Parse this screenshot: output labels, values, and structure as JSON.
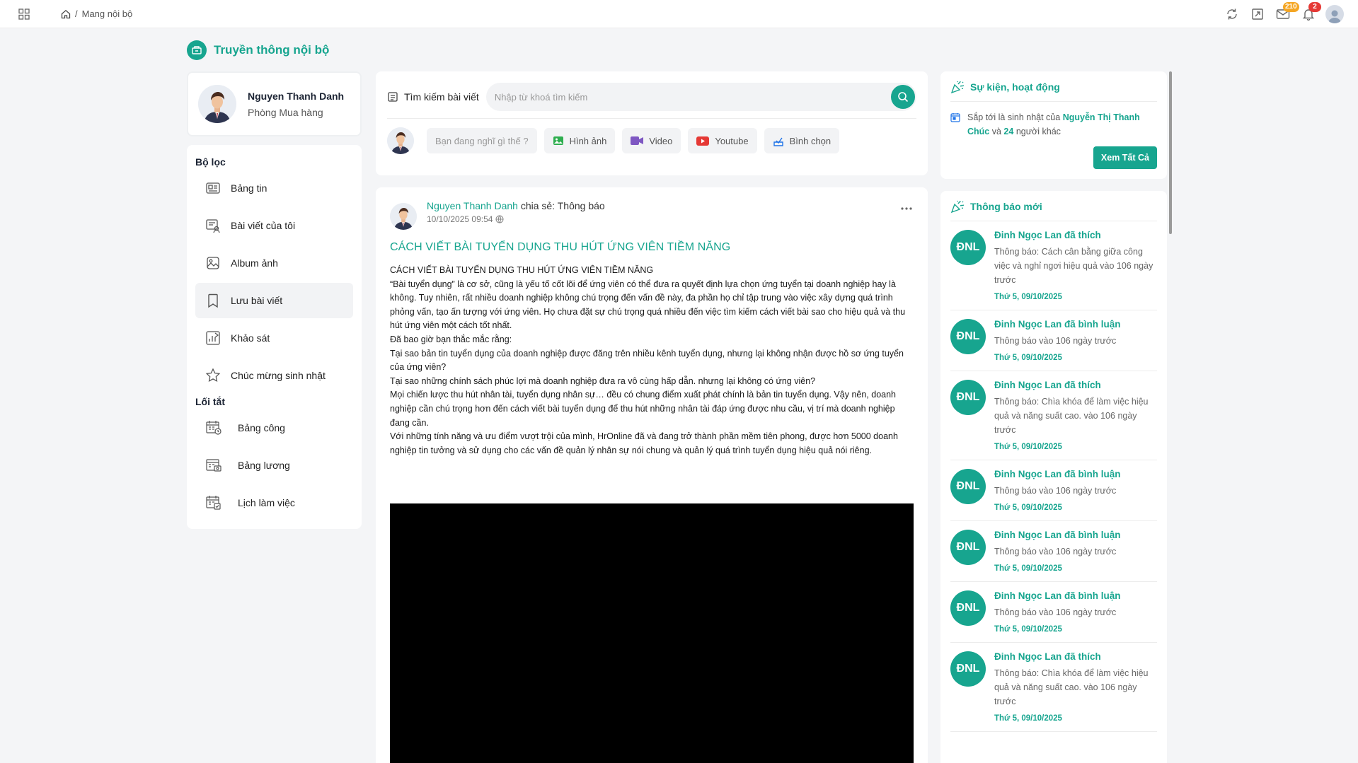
{
  "topbar": {
    "breadcrumb_sep": "/",
    "breadcrumb_current": "Mang nội bộ",
    "mail_badge": "210",
    "bell_badge": "2"
  },
  "page": {
    "title": "Truyền thông nội bộ"
  },
  "profile": {
    "name": "Nguyen Thanh Danh",
    "department": "Phòng Mua hàng"
  },
  "filters": {
    "heading": "Bộ lọc",
    "items": [
      {
        "label": "Bảng tin",
        "icon": "newspaper-icon"
      },
      {
        "label": "Bài viết của tôi",
        "icon": "my-posts-icon"
      },
      {
        "label": "Album ảnh",
        "icon": "image-album-icon"
      },
      {
        "label": "Lưu bài viết",
        "icon": "bookmark-icon"
      },
      {
        "label": "Khảo sát",
        "icon": "survey-chart-icon"
      },
      {
        "label": "Chúc mừng sinh nhật",
        "icon": "star-icon"
      }
    ]
  },
  "shortcuts": {
    "heading": "Lối tắt",
    "items": [
      {
        "label": "Bảng công",
        "icon": "timesheet-icon"
      },
      {
        "label": "Bảng lương",
        "icon": "payroll-icon"
      },
      {
        "label": "Lịch làm việc",
        "icon": "schedule-icon"
      }
    ]
  },
  "composer": {
    "search_label": "Tìm kiếm bài viết",
    "search_placeholder": "Nhập từ khoá tìm kiếm",
    "status_placeholder": "Bạn đang nghĩ gì thế ?",
    "image_label": "Hình ảnh",
    "video_label": "Video",
    "youtube_label": "Youtube",
    "poll_label": "Bình chọn"
  },
  "post": {
    "author": "Nguyen Thanh Danh",
    "shared_text": "chia sẻ: Thông báo",
    "date": "10/10/2025 09:54",
    "title": "CÁCH VIẾT BÀI TUYỂN DỤNG THU HÚT ỨNG VIÊN TIỀM NĂNG",
    "paragraphs": [
      "CÁCH VIẾT BÀI TUYỂN DỤNG THU HÚT ỨNG VIÊN TIỀM NĂNG",
      "“Bài tuyển dụng” là cơ sở, cũng là yếu tố cốt lõi để ứng viên có thể đưa ra quyết định lựa chọn ứng tuyển tại doanh nghiệp hay là không. Tuy nhiên, rất nhiều doanh nghiệp không chú trọng đến vấn đề này, đa phần họ chỉ tập trung vào việc xây dựng quá trình phỏng vấn, tạo ấn tượng với ứng viên. Họ chưa đặt sự chú trọng quá nhiều đến việc tìm kiếm cách viết bài sao cho hiệu quả và thu hút ứng viên một cách tốt nhất.",
      "Đã bao giờ bạn thắc mắc rằng:",
      "Tại sao bản tin tuyển dụng của doanh nghiệp được đăng trên nhiều kênh tuyển dụng, nhưng lại không nhận được hồ sơ ứng tuyển của ứng viên?",
      "Tại sao những chính sách phúc lợi mà doanh nghiệp đưa ra vô cùng hấp dẫn. nhưng lại không có ứng viên?",
      " Mọi chiến lược thu hút nhân tài, tuyển dụng nhân sự… đều có chung điểm xuất phát chính là bản tin tuyển dụng. Vậy nên, doanh nghiệp cần chú trọng hơn đến cách viết bài tuyển dụng để thu hút những nhân tài đáp ứng được nhu cầu, vị trí mà doanh nghiệp đang cần.",
      "Với những tính năng và ưu điểm vượt trội của mình, HrOnline đã và đang trở thành phần mềm tiên phong, được hơn 5000 doanh nghiệp tin tưởng và sử dụng cho các vấn đề quản lý nhân sự nói chung và quản lý quá trình tuyển dụng hiệu quả nói riêng."
    ]
  },
  "events": {
    "heading": "Sự kiện, hoạt động",
    "text_before": "Sắp tới là sinh nhật của",
    "person": "Nguyễn Thị Thanh Chúc",
    "text_and": "và",
    "count": "24",
    "text_after": "người khác",
    "button": "Xem Tất Cả"
  },
  "notifications": {
    "heading": "Thông báo mới",
    "items": [
      {
        "initials": "ĐNL",
        "title": "Đinh Ngọc Lan đã thích",
        "desc": "Thông báo: Cách cân bằng giữa công việc và nghỉ ngơi hiệu quả vào 106 ngày trước",
        "date": "Thứ 5, 09/10/2025"
      },
      {
        "initials": "ĐNL",
        "title": "Đinh Ngọc Lan đã bình luận",
        "desc": "Thông báo vào 106 ngày trước",
        "date": "Thứ 5, 09/10/2025"
      },
      {
        "initials": "ĐNL",
        "title": "Đinh Ngọc Lan đã thích",
        "desc": "Thông báo: Chìa khóa để làm việc hiệu quả và năng suất cao. vào 106 ngày trước",
        "date": "Thứ 5, 09/10/2025"
      },
      {
        "initials": "ĐNL",
        "title": "Đinh Ngọc Lan đã bình luận",
        "desc": "Thông báo vào 106 ngày trước",
        "date": "Thứ 5, 09/10/2025"
      },
      {
        "initials": "ĐNL",
        "title": "Đinh Ngọc Lan đã bình luận",
        "desc": "Thông báo vào 106 ngày trước",
        "date": "Thứ 5, 09/10/2025"
      },
      {
        "initials": "ĐNL",
        "title": "Đinh Ngọc Lan đã bình luận",
        "desc": "Thông báo vào 106 ngày trước",
        "date": "Thứ 5, 09/10/2025"
      },
      {
        "initials": "ĐNL",
        "title": "Đinh Ngọc Lan đã thích",
        "desc": "Thông báo: Chìa khóa để làm việc hiệu quả và năng suất cao. vào 106 ngày trước",
        "date": "Thứ 5, 09/10/2025"
      }
    ]
  },
  "colors": {
    "accent": "#17a58f",
    "badge_orange": "#f5a623",
    "badge_red": "#e53935"
  }
}
